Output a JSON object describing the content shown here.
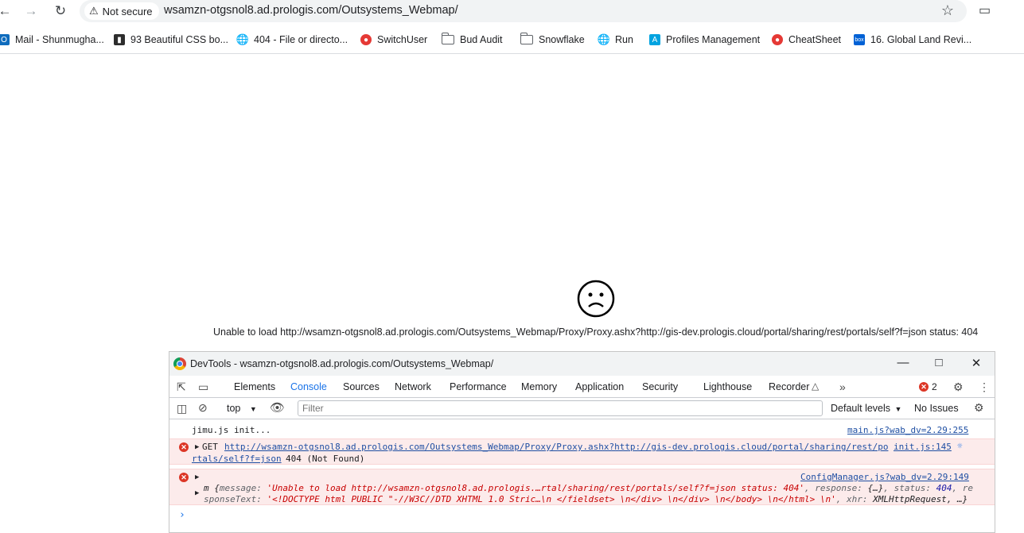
{
  "browser": {
    "security_label": "Not secure",
    "url": "wsamzn-otgsnol8.ad.prologis.com/Outsystems_Webmap/"
  },
  "bookmarks": [
    {
      "label": "Mail - Shunmugha...",
      "icon": "outlook-icon",
      "color": "#0f6cbd"
    },
    {
      "label": "93 Beautiful CSS bo...",
      "icon": "bookmark-site-icon",
      "color": "#2d2d2d"
    },
    {
      "label": "404 - File or directo...",
      "icon": "globe-icon",
      "color": "#5f6368"
    },
    {
      "label": "SwitchUser",
      "icon": "record-icon",
      "color": "#e53935"
    },
    {
      "label": "Bud Audit",
      "icon": "folder-icon",
      "color": "#5f6368"
    },
    {
      "label": "Snowflake",
      "icon": "folder-icon",
      "color": "#5f6368"
    },
    {
      "label": "Run",
      "icon": "globe-icon",
      "color": "#5f6368"
    },
    {
      "label": "Profiles Management",
      "icon": "profiles-icon",
      "color": "#00a3e0"
    },
    {
      "label": "CheatSheet",
      "icon": "record-icon",
      "color": "#e53935"
    },
    {
      "label": "16. Global Land Revi...",
      "icon": "box-icon",
      "color": "#0061d5"
    }
  ],
  "page": {
    "error_message": "Unable to load http://wsamzn-otgsnol8.ad.prologis.com/Outsystems_Webmap/Proxy/Proxy.ashx?http://gis-dev.prologis.cloud/portal/sharing/rest/portals/self?f=json status: 404"
  },
  "devtools": {
    "title": "DevTools - wsamzn-otgsnol8.ad.prologis.com/Outsystems_Webmap/",
    "tabs": [
      "Elements",
      "Console",
      "Sources",
      "Network",
      "Performance",
      "Memory",
      "Application",
      "Security",
      "Lighthouse",
      "Recorder"
    ],
    "active_tab": "Console",
    "error_count": "2",
    "context": "top",
    "filter_placeholder": "Filter",
    "levels_label": "Default levels",
    "issues_label": "No Issues",
    "console": {
      "line1_text": "jimu.js init...",
      "line1_src": "main.js?wab_dv=2.29:255",
      "line2_method": "GET",
      "line2_url_a": "http://wsamzn-otgsnol8.ad.prologis.com/Outsystems_Webmap/Proxy/Proxy.ashx?http://gis-dev.prologis.cloud/portal/sharing/rest/po",
      "line2_url_b": "rtals/self?f=json",
      "line2_status": "404 (Not Found)",
      "line2_src": "init.js:145",
      "line3_src": "ConfigManager.js?wab_dv=2.29:149",
      "line3_prefix": "m {",
      "line3_key1": "message: ",
      "line3_val1": "'Unable to load http://wsamzn-otgsnol8.ad.prologis.…rtal/sharing/rest/portals/self?f=json status: 404'",
      "line3_key2": ", response: ",
      "line3_val2": "{…}",
      "line3_key3": ", status: ",
      "line3_val3": "404",
      "line3_key4": ", re",
      "line4_key4": "sponseText: ",
      "line4_val4": "'<!DOCTYPE html PUBLIC \"-//W3C//DTD XHTML 1.0 Stric…\\n </fieldset> \\n</div> \\n</div> \\n</body> \\n</html> \\n'",
      "line4_key5": ", xhr: ",
      "line4_val5": "XMLHttpRequest",
      "line4_tail": ", …}"
    }
  }
}
